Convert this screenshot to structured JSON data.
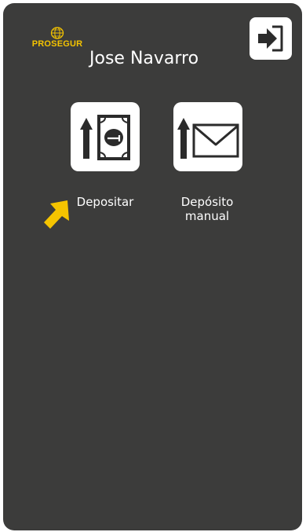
{
  "header": {
    "brand": "PROSEGUR",
    "user_name": "Jose Navarro"
  },
  "actions": [
    {
      "label": "Depositar"
    },
    {
      "label": "Depósito\nmanual"
    }
  ],
  "colors": {
    "background": "#3c3c3b",
    "brand": "#f5c400",
    "tile": "#ffffff",
    "icon": "#2b2b2b",
    "pointer": "#f5c400"
  },
  "icons": {
    "logout": "logout-arrow-icon",
    "deposit": "deposit-banknote-icon",
    "manual": "manual-deposit-envelope-icon",
    "pointer": "yellow-pointer-arrow-icon"
  }
}
